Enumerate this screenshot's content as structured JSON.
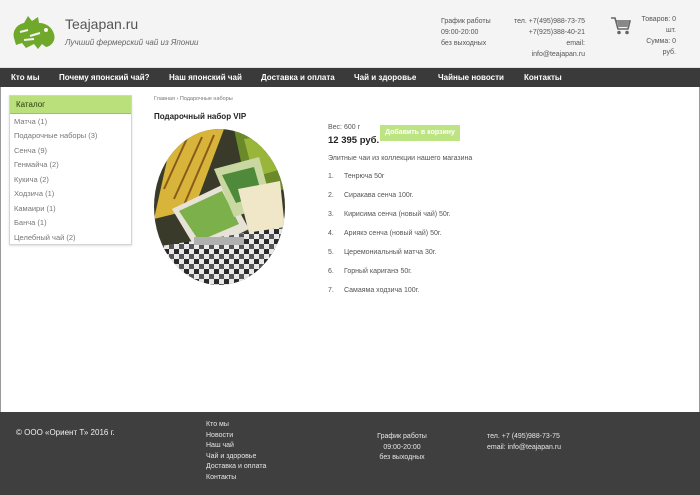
{
  "header": {
    "site_name": "Teajapan.ru",
    "tagline": "Лучший фермерский чай из Японии",
    "hours": [
      "График работы",
      "09:00-20:00",
      "без выходных"
    ],
    "phones": [
      "тел. +7(495)988-73-75",
      "+7(925)388-40-21",
      "email: info@teajapan.ru"
    ],
    "cart": [
      "Товаров: 0 шт.",
      "Сумма: 0 руб."
    ]
  },
  "nav": [
    "Кто мы",
    "Почему японский чай?",
    "Наш японский чай",
    "Доставка и оплата",
    "Чай и здоровье",
    "Чайные новости",
    "Контакты"
  ],
  "catalog": {
    "title": "Каталог",
    "items": [
      "Матча (1)",
      "Подарочные наборы (3)",
      "Сенча (9)",
      "Генмайча (2)",
      "Кукича (2)",
      "Ходзича (1)",
      "Камаири (1)",
      "Банча (1)",
      "Целебный чай (2)"
    ]
  },
  "breadcrumb": "Главная › Подарочные наборы",
  "product": {
    "title": "Подарочный набор VIP",
    "weight": "Вес: 600 г",
    "price": "12 395 руб.",
    "add_to_cart": "Добавить в корзину",
    "intro": "Элитные чаи из коллекции нашего магазина",
    "teas": [
      "Тенрюча 50г",
      "Сиракава сенча 100г.",
      "Кирисима сенча (новый чай) 50г.",
      "Ариякэ сенча (новый чай) 50г.",
      "Церемониальный матча 30г.",
      "Горный кариганэ 50г.",
      "Самаяма ходзича 100г."
    ]
  },
  "footer": {
    "copyright": "©  ООО «Ориент Т» 2016 г.",
    "links": [
      "Кто мы",
      "Новости",
      "Наш чай",
      "Чай и здоровье",
      "Доставка и оплата",
      "Контакты"
    ],
    "hours": [
      "График работы",
      "09:00-20:00",
      "без выходных"
    ],
    "contacts": [
      "тел. +7 (495)988-73-75",
      "email: info@teajapan.ru"
    ]
  },
  "colors": {
    "accent": "#b9e07a",
    "nav_bg": "#3a3a3a",
    "footer_bg": "#3f3f3f"
  }
}
